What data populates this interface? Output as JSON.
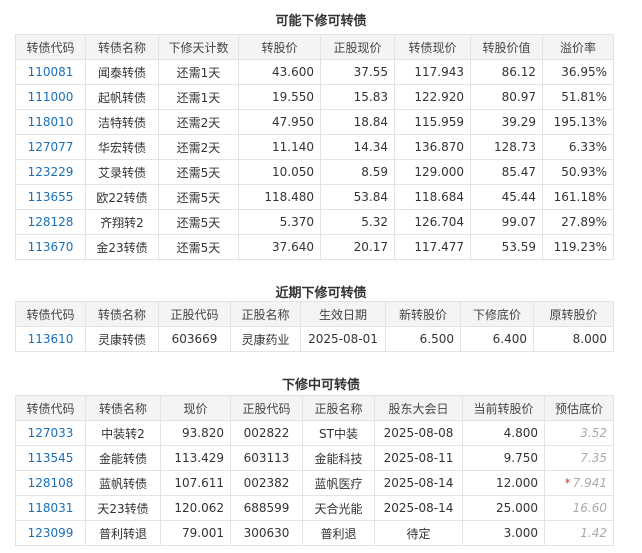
{
  "t1": {
    "title": "可能下修可转债",
    "headers": [
      "转债代码",
      "转债名称",
      "下修天计数",
      "转股价",
      "正股现价",
      "转债现价",
      "转股价值",
      "溢价率"
    ],
    "rows": [
      [
        "110081",
        "闻泰转债",
        "还需1天",
        "43.600",
        "37.55",
        "117.943",
        "86.12",
        "36.95%"
      ],
      [
        "111000",
        "起帆转债",
        "还需1天",
        "19.550",
        "15.83",
        "122.920",
        "80.97",
        "51.81%"
      ],
      [
        "118010",
        "洁特转债",
        "还需2天",
        "47.950",
        "18.84",
        "115.959",
        "39.29",
        "195.13%"
      ],
      [
        "127077",
        "华宏转债",
        "还需2天",
        "11.140",
        "14.34",
        "136.870",
        "128.73",
        "6.33%"
      ],
      [
        "123229",
        "艾录转债",
        "还需5天",
        "10.050",
        "8.59",
        "129.000",
        "85.47",
        "50.93%"
      ],
      [
        "113655",
        "欧22转债",
        "还需5天",
        "118.480",
        "53.84",
        "118.684",
        "45.44",
        "161.18%"
      ],
      [
        "128128",
        "齐翔转2",
        "还需5天",
        "5.370",
        "5.32",
        "126.704",
        "99.07",
        "27.89%"
      ],
      [
        "113670",
        "金23转债",
        "还需5天",
        "37.640",
        "20.17",
        "117.477",
        "53.59",
        "119.23%"
      ]
    ]
  },
  "t2": {
    "title": "近期下修可转债",
    "headers": [
      "转债代码",
      "转债名称",
      "正股代码",
      "正股名称",
      "生效日期",
      "新转股价",
      "下修底价",
      "原转股价"
    ],
    "rows": [
      [
        "113610",
        "灵康转债",
        "603669",
        "灵康药业",
        "2025-08-01",
        "6.500",
        "6.400",
        "8.000"
      ]
    ]
  },
  "t3": {
    "title": "下修中可转债",
    "headers": [
      "转债代码",
      "转债名称",
      "现价",
      "正股代码",
      "正股名称",
      "股东大会日",
      "当前转股价",
      "预估底价"
    ],
    "rows": [
      [
        "127033",
        "中装转2",
        "93.820",
        "002822",
        "ST中装",
        "2025-08-08",
        "4.800",
        "3.52"
      ],
      [
        "113545",
        "金能转债",
        "113.429",
        "603113",
        "金能科技",
        "2025-08-11",
        "9.750",
        "7.35"
      ],
      [
        "128108",
        "蓝帆转债",
        "107.611",
        "002382",
        "蓝帆医疗",
        "2025-08-14",
        "12.000",
        "7.941"
      ],
      [
        "118031",
        "天23转债",
        "120.062",
        "688599",
        "天合光能",
        "2025-08-14",
        "25.000",
        "16.60"
      ],
      [
        "123099",
        "普利转退",
        "79.001",
        "300630",
        "普利退",
        "待定",
        "3.000",
        "1.42"
      ]
    ],
    "star_mark": "*"
  }
}
